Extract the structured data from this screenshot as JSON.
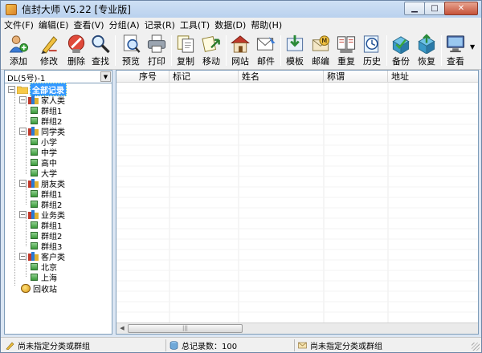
{
  "window": {
    "title": "信封大师 V5.22 [专业版]",
    "accent": "#3399ff"
  },
  "menu": [
    {
      "label": "文件(F)"
    },
    {
      "label": "编辑(E)"
    },
    {
      "label": "查看(V)"
    },
    {
      "label": "分组(A)"
    },
    {
      "label": "记录(R)"
    },
    {
      "label": "工具(T)"
    },
    {
      "label": "数据(D)"
    },
    {
      "label": "帮助(H)"
    }
  ],
  "toolbar": [
    {
      "label": "添加",
      "icon": "add-person-icon"
    },
    {
      "label": "修改",
      "icon": "edit-pen-icon"
    },
    {
      "label": "删除",
      "icon": "delete-icon"
    },
    {
      "label": "查找",
      "icon": "magnifier-icon"
    },
    {
      "label": "预览",
      "icon": "preview-icon"
    },
    {
      "label": "打印",
      "icon": "printer-icon"
    },
    {
      "label": "复制",
      "icon": "copy-icon"
    },
    {
      "label": "移动",
      "icon": "move-icon"
    },
    {
      "label": "网站",
      "icon": "house-icon"
    },
    {
      "label": "邮件",
      "icon": "mail-icon"
    },
    {
      "label": "模板",
      "icon": "template-icon"
    },
    {
      "label": "邮编",
      "icon": "postcode-icon"
    },
    {
      "label": "重复",
      "icon": "duplicate-icon"
    },
    {
      "label": "历史",
      "icon": "history-icon"
    },
    {
      "label": "备份",
      "icon": "backup-icon"
    },
    {
      "label": "恢复",
      "icon": "restore-icon"
    },
    {
      "label": "查看",
      "icon": "monitor-icon"
    }
  ],
  "left_pane": {
    "envelope_select": "DL(5号)-1",
    "tree": {
      "root": "全部记录",
      "categories": [
        {
          "label": "家人类",
          "groups": [
            "群组1",
            "群组2"
          ]
        },
        {
          "label": "同学类",
          "groups": [
            "小学",
            "中学",
            "高中",
            "大学"
          ]
        },
        {
          "label": "朋友类",
          "groups": [
            "群组1",
            "群组2"
          ]
        },
        {
          "label": "业务类",
          "groups": [
            "群组1",
            "群组2",
            "群组3"
          ]
        },
        {
          "label": "客户类",
          "groups": [
            "北京",
            "上海"
          ]
        }
      ],
      "recycle": "回收站"
    }
  },
  "table": {
    "columns": [
      "序号",
      "标记",
      "姓名",
      "称谓",
      "地址"
    ],
    "rows": []
  },
  "status": {
    "left": "尚未指定分类或群组",
    "count": "总记录数：100",
    "right": "尚未指定分类或群组"
  }
}
